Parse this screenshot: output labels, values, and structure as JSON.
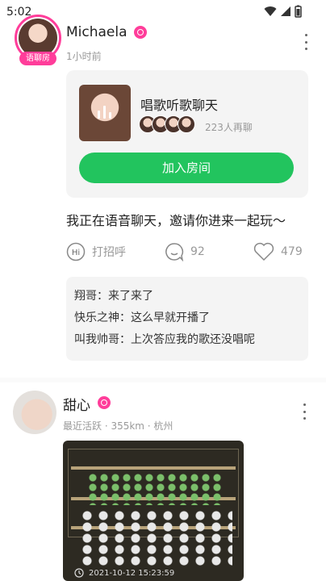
{
  "status_bar": {
    "time": "5:02"
  },
  "post1": {
    "avatar_tag": "语聊房",
    "username": "Michaela",
    "time_ago": "1小时前",
    "room": {
      "title": "唱歌听歌聊天",
      "listener_count": "223人再聊",
      "join_label": "加入房间"
    },
    "text": "我正在语音聊天，邀请你进来一起玩～",
    "actions": {
      "greet_label": "打招呼",
      "comment_count": "92",
      "like_count": "479"
    },
    "comments": [
      "翔哥：来了来了",
      "快乐之神：这么早就开播了",
      "叫我帅哥：上次答应我的歌还没唱呢"
    ]
  },
  "post2": {
    "username": "甜心",
    "meta": "最近活跃 · 355km · 杭州",
    "photo_timestamp": "2021-10-12  15:23:59"
  },
  "colors": {
    "accent_pink": "#ff3d9a",
    "join_green": "#22c45e"
  }
}
